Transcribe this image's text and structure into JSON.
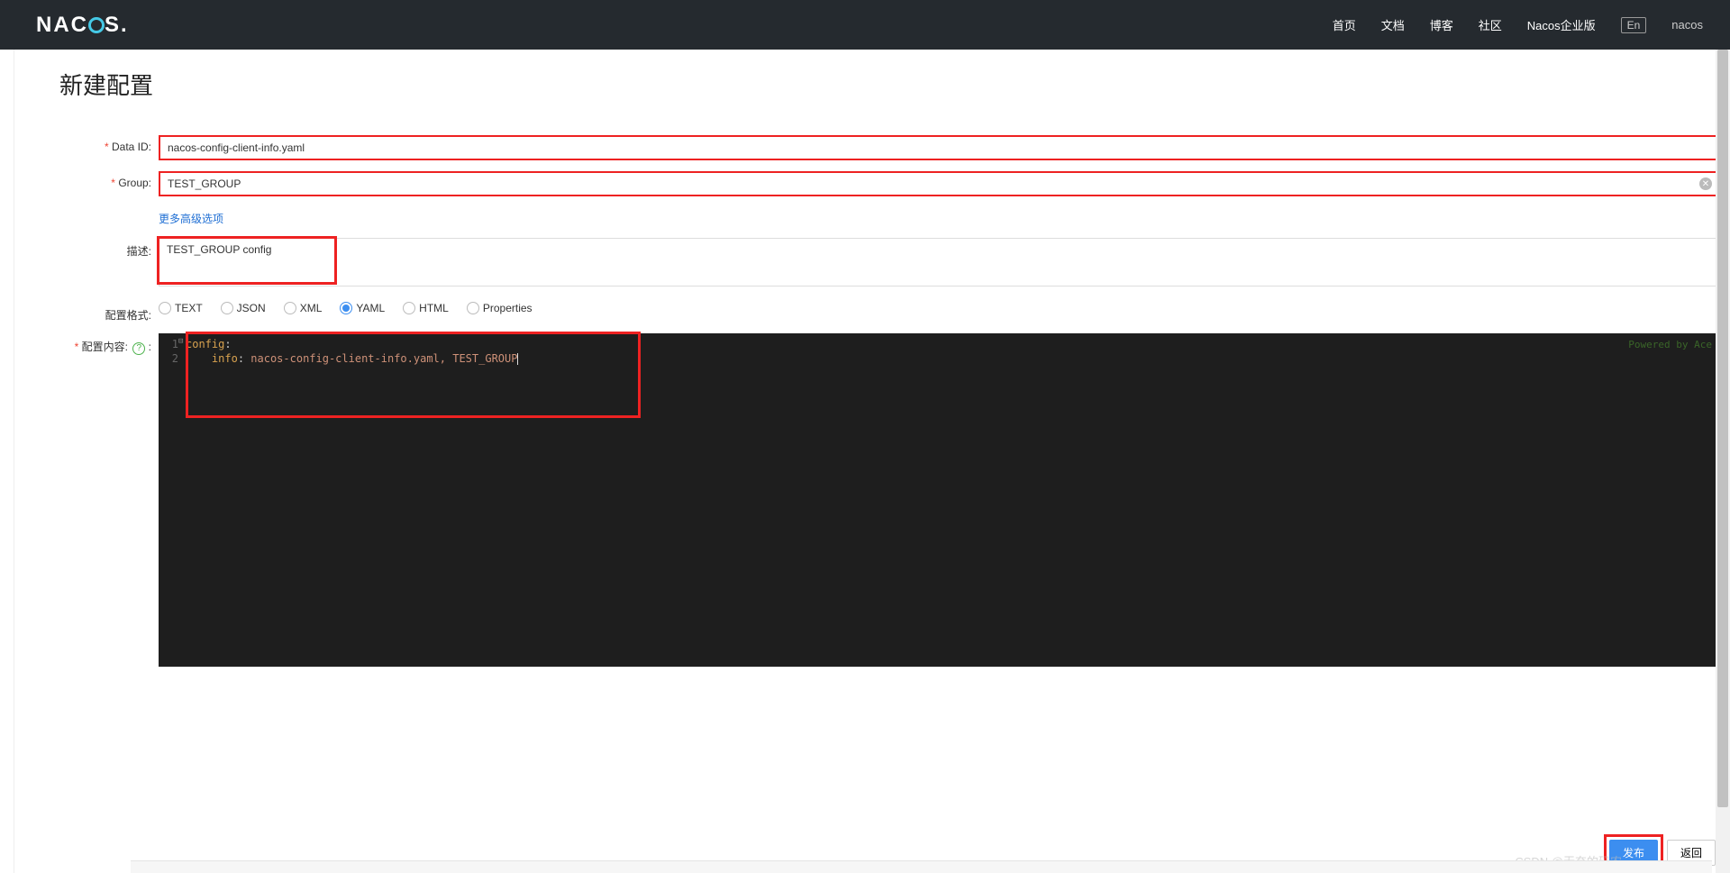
{
  "header": {
    "logo_text": "NACOS",
    "nav": {
      "home": "首页",
      "docs": "文档",
      "blog": "博客",
      "community": "社区",
      "enterprise": "Nacos企业版"
    },
    "lang": "En",
    "user": "nacos"
  },
  "page": {
    "title": "新建配置",
    "labels": {
      "data_id": "Data ID:",
      "group": "Group:",
      "adv": "更多高级选项",
      "desc": "描述:",
      "format": "配置格式:",
      "content": "配置内容:"
    },
    "values": {
      "data_id": "nacos-config-client-info.yaml",
      "group": "TEST_GROUP",
      "desc": "TEST_GROUP config"
    },
    "formats": [
      "TEXT",
      "JSON",
      "XML",
      "YAML",
      "HTML",
      "Properties"
    ],
    "format_selected": "YAML",
    "editor": {
      "line1_key": "config",
      "line2_key": "info",
      "line2_val": "nacos-config-client-info.yaml, TEST_GROUP",
      "powered": "Powered by Ace"
    },
    "buttons": {
      "publish": "发布",
      "back": "返回"
    }
  },
  "watermark": "CSDN @无奈的码农"
}
